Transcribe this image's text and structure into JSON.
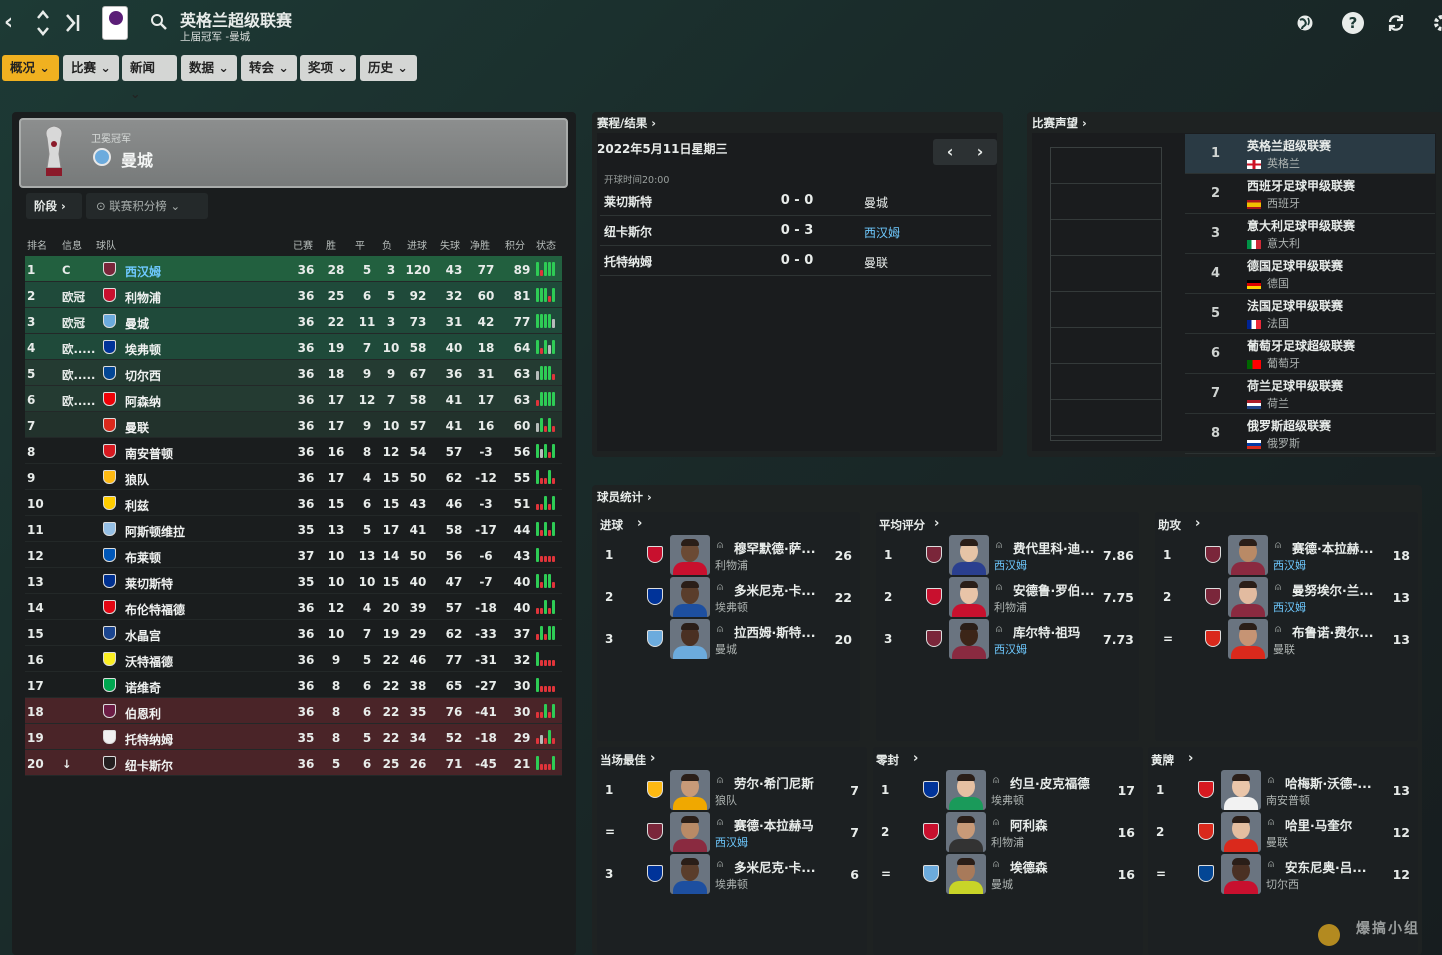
{
  "header": {
    "title": "英格兰超级联赛",
    "subtitle": "上届冠军 -曼城",
    "logo_text": "Premier League"
  },
  "menu": [
    {
      "label": "概况"
    },
    {
      "label": "比赛"
    },
    {
      "label": "新闻"
    },
    {
      "label": "数据"
    },
    {
      "label": "转会"
    },
    {
      "label": "奖项"
    },
    {
      "label": "历史"
    }
  ],
  "champion": {
    "label": "卫冕冠军",
    "team": "曼城"
  },
  "stage": {
    "label": "阶段",
    "selector": "联赛积分榜"
  },
  "table": {
    "headers": [
      "排名",
      "信息",
      "球队",
      "已赛",
      "胜",
      "平",
      "负",
      "进球",
      "失球",
      "净胜",
      "积分",
      "状态"
    ],
    "rows": [
      {
        "pos": "1",
        "info": "C",
        "team": "西汉姆",
        "p": "36",
        "w": "28",
        "d": "5",
        "l": "3",
        "gf": "120",
        "ga": "43",
        "gd": "77",
        "pts": "89",
        "color": "#7a263a",
        "zone": "cl",
        "form": "WLWWW"
      },
      {
        "pos": "2",
        "info": "欧冠",
        "team": "利物浦",
        "p": "36",
        "w": "25",
        "d": "6",
        "l": "5",
        "gf": "92",
        "ga": "32",
        "gd": "60",
        "pts": "81",
        "color": "#c8102e",
        "zone": "cl",
        "form": "WWWLW"
      },
      {
        "pos": "3",
        "info": "欧冠",
        "team": "曼城",
        "p": "36",
        "w": "22",
        "d": "11",
        "l": "3",
        "gf": "73",
        "ga": "31",
        "gd": "42",
        "pts": "77",
        "color": "#6cabdd",
        "zone": "cl",
        "form": "WWWWD"
      },
      {
        "pos": "4",
        "info": "欧.....",
        "team": "埃弗顿",
        "p": "36",
        "w": "19",
        "d": "7",
        "l": "10",
        "gf": "58",
        "ga": "40",
        "gd": "18",
        "pts": "64",
        "color": "#003399",
        "zone": "cl",
        "form": "WLWDW"
      },
      {
        "pos": "5",
        "info": "欧.....",
        "team": "切尔西",
        "p": "36",
        "w": "18",
        "d": "9",
        "l": "9",
        "gf": "67",
        "ga": "36",
        "gd": "31",
        "pts": "63",
        "color": "#034694",
        "zone": "el",
        "form": "DWWWL"
      },
      {
        "pos": "6",
        "info": "欧.....",
        "team": "阿森纳",
        "p": "36",
        "w": "17",
        "d": "12",
        "l": "7",
        "gf": "58",
        "ga": "41",
        "gd": "17",
        "pts": "63",
        "color": "#ef0107",
        "zone": "el",
        "form": "LWWWW"
      },
      {
        "pos": "7",
        "info": "",
        "team": "曼联",
        "p": "36",
        "w": "17",
        "d": "9",
        "l": "10",
        "gf": "57",
        "ga": "41",
        "gd": "16",
        "pts": "60",
        "color": "#da291c",
        "zone": "conf",
        "form": "DWLWL"
      },
      {
        "pos": "8",
        "info": "",
        "team": "南安普顿",
        "p": "36",
        "w": "16",
        "d": "8",
        "l": "12",
        "gf": "54",
        "ga": "57",
        "gd": "-3",
        "pts": "56",
        "color": "#d71920",
        "zone": "",
        "form": "WDWLW"
      },
      {
        "pos": "9",
        "info": "",
        "team": "狼队",
        "p": "36",
        "w": "17",
        "d": "4",
        "l": "15",
        "gf": "50",
        "ga": "62",
        "gd": "-12",
        "pts": "55",
        "color": "#fdb913",
        "zone": "",
        "form": "WLLWL"
      },
      {
        "pos": "10",
        "info": "",
        "team": "利兹",
        "p": "36",
        "w": "15",
        "d": "6",
        "l": "15",
        "gf": "43",
        "ga": "46",
        "gd": "-3",
        "pts": "51",
        "color": "#ffcd00",
        "zone": "",
        "form": "LLWLW"
      },
      {
        "pos": "11",
        "info": "",
        "team": "阿斯顿维拉",
        "p": "35",
        "w": "13",
        "d": "5",
        "l": "17",
        "gf": "41",
        "ga": "58",
        "gd": "-17",
        "pts": "44",
        "color": "#95bfe5",
        "zone": "",
        "form": "WLWLW"
      },
      {
        "pos": "12",
        "info": "",
        "team": "布莱顿",
        "p": "37",
        "w": "10",
        "d": "13",
        "l": "14",
        "gf": "50",
        "ga": "56",
        "gd": "-6",
        "pts": "43",
        "color": "#0057b8",
        "zone": "",
        "form": "WLLLL"
      },
      {
        "pos": "13",
        "info": "",
        "team": "莱切斯特",
        "p": "35",
        "w": "10",
        "d": "10",
        "l": "15",
        "gf": "40",
        "ga": "47",
        "gd": "-7",
        "pts": "40",
        "color": "#003090",
        "zone": "",
        "form": "WLWWL"
      },
      {
        "pos": "14",
        "info": "",
        "team": "布伦特福德",
        "p": "36",
        "w": "12",
        "d": "4",
        "l": "20",
        "gf": "39",
        "ga": "57",
        "gd": "-18",
        "pts": "40",
        "color": "#e30613",
        "zone": "",
        "form": "LLWLW"
      },
      {
        "pos": "15",
        "info": "",
        "team": "水晶宫",
        "p": "36",
        "w": "10",
        "d": "7",
        "l": "19",
        "gf": "29",
        "ga": "62",
        "gd": "-33",
        "pts": "37",
        "color": "#1b458f",
        "zone": "",
        "form": "LWLWW"
      },
      {
        "pos": "16",
        "info": "",
        "team": "沃特福德",
        "p": "36",
        "w": "9",
        "d": "5",
        "l": "22",
        "gf": "46",
        "ga": "77",
        "gd": "-31",
        "pts": "32",
        "color": "#fbee23",
        "zone": "",
        "form": "WLLLL"
      },
      {
        "pos": "17",
        "info": "",
        "team": "诺维奇",
        "p": "36",
        "w": "8",
        "d": "6",
        "l": "22",
        "gf": "38",
        "ga": "65",
        "gd": "-27",
        "pts": "30",
        "color": "#00a650",
        "zone": "",
        "form": "WLLLL"
      },
      {
        "pos": "18",
        "info": "",
        "team": "伯恩利",
        "p": "36",
        "w": "8",
        "d": "6",
        "l": "22",
        "gf": "35",
        "ga": "76",
        "gd": "-41",
        "pts": "30",
        "color": "#6c1d45",
        "zone": "rel",
        "form": "LLWLW"
      },
      {
        "pos": "19",
        "info": "",
        "team": "托特纳姆",
        "p": "35",
        "w": "8",
        "d": "5",
        "l": "22",
        "gf": "34",
        "ga": "52",
        "gd": "-18",
        "pts": "29",
        "color": "#f0f0f0",
        "zone": "rel",
        "form": "LDLWL"
      },
      {
        "pos": "20",
        "info": "↓",
        "team": "纽卡斯尔",
        "p": "36",
        "w": "5",
        "d": "6",
        "l": "25",
        "gf": "26",
        "ga": "71",
        "gd": "-45",
        "pts": "21",
        "color": "#241f20",
        "zone": "rel",
        "form": "WLLLW"
      }
    ]
  },
  "fixtures": {
    "title": "赛程/结果",
    "date": "2022年5月11日星期三",
    "kickoff": "开球时间20:00",
    "matches": [
      {
        "home": "莱切斯特",
        "score": "0 - 0",
        "away": "曼城",
        "away_link": false
      },
      {
        "home": "纽卡斯尔",
        "score": "0 - 3",
        "away": "西汉姆",
        "away_link": true
      },
      {
        "home": "托特纳姆",
        "score": "0 - 0",
        "away": "曼联",
        "away_link": false
      }
    ]
  },
  "reputation": {
    "title": "比赛声望",
    "items": [
      {
        "rank": "1",
        "name": "英格兰超级联赛",
        "country": "英格兰",
        "flag": "eng"
      },
      {
        "rank": "2",
        "name": "西班牙足球甲级联赛",
        "country": "西班牙",
        "flag": "esp"
      },
      {
        "rank": "3",
        "name": "意大利足球甲级联赛",
        "country": "意大利",
        "flag": "ita"
      },
      {
        "rank": "4",
        "name": "德国足球甲级联赛",
        "country": "德国",
        "flag": "ger"
      },
      {
        "rank": "5",
        "name": "法国足球甲级联赛",
        "country": "法国",
        "flag": "fra"
      },
      {
        "rank": "6",
        "name": "葡萄牙足球超级联赛",
        "country": "葡萄牙",
        "flag": "por"
      },
      {
        "rank": "7",
        "name": "荷兰足球甲级联赛",
        "country": "荷兰",
        "flag": "ned"
      },
      {
        "rank": "8",
        "name": "俄罗斯超级联赛",
        "country": "俄罗斯",
        "flag": "rus"
      }
    ]
  },
  "player_stats": {
    "title": "球员统计",
    "cards": [
      {
        "title": "进球",
        "rows": [
          {
            "rank": "1",
            "name": "穆罕默德·萨...",
            "club": "利物浦",
            "value": "26",
            "crest": "#c8102e",
            "skin": "#6b4a34",
            "kit": "#c8102e",
            "link": false
          },
          {
            "rank": "2",
            "name": "多米尼克·卡...",
            "club": "埃弗顿",
            "value": "22",
            "crest": "#003399",
            "skin": "#5a3d2b",
            "kit": "#1d4fa0",
            "link": false
          },
          {
            "rank": "3",
            "name": "拉西姆·斯特...",
            "club": "曼城",
            "value": "20",
            "crest": "#6cabdd",
            "skin": "#4a3023",
            "kit": "#6cabdd",
            "link": false
          }
        ]
      },
      {
        "title": "平均评分",
        "rows": [
          {
            "rank": "1",
            "name": "费代里科·迪...",
            "club": "西汉姆",
            "value": "7.86",
            "crest": "#7a263a",
            "skin": "#e6c4a6",
            "kit": "#2a3f8f",
            "link": true
          },
          {
            "rank": "2",
            "name": "安德鲁·罗伯...",
            "club": "利物浦",
            "value": "7.75",
            "crest": "#c8102e",
            "skin": "#e8c4a8",
            "kit": "#c8102e",
            "link": false
          },
          {
            "rank": "3",
            "name": "库尔特·祖玛",
            "club": "西汉姆",
            "value": "7.73",
            "crest": "#7a263a",
            "skin": "#3c2518",
            "kit": "#8a2a40",
            "link": true
          }
        ]
      },
      {
        "title": "助攻",
        "rows": [
          {
            "rank": "1",
            "name": "赛德·本拉赫...",
            "club": "西汉姆",
            "value": "18",
            "crest": "#7a263a",
            "skin": "#b98a66",
            "kit": "#8a2a40",
            "link": true
          },
          {
            "rank": "2",
            "name": "曼努埃尔·兰...",
            "club": "西汉姆",
            "value": "13",
            "crest": "#7a263a",
            "skin": "#e2bba0",
            "kit": "#8a2a40",
            "link": true
          },
          {
            "rank": "=",
            "name": "布鲁诺·费尔...",
            "club": "曼联",
            "value": "13",
            "crest": "#da291c",
            "skin": "#c69474",
            "kit": "#da291c",
            "link": false
          }
        ]
      },
      {
        "title": "当场最佳",
        "rows": [
          {
            "rank": "1",
            "name": "劳尔·希门尼斯",
            "club": "狼队",
            "value": "7",
            "crest": "#fdb913",
            "skin": "#c89a78",
            "kit": "#f0a800",
            "link": false
          },
          {
            "rank": "=",
            "name": "赛德·本拉赫马",
            "club": "西汉姆",
            "value": "7",
            "crest": "#7a263a",
            "skin": "#b98a66",
            "kit": "#8a2a40",
            "link": true
          },
          {
            "rank": "3",
            "name": "多米尼克·卡...",
            "club": "埃弗顿",
            "value": "6",
            "crest": "#003399",
            "skin": "#5a3d2b",
            "kit": "#1d4fa0",
            "link": false
          }
        ]
      },
      {
        "title": "零封",
        "rows": [
          {
            "rank": "1",
            "name": "约旦·皮克福德",
            "club": "埃弗顿",
            "value": "17",
            "crest": "#003399",
            "skin": "#e6c0a2",
            "kit": "#1a9a5a",
            "link": false
          },
          {
            "rank": "2",
            "name": "阿利森",
            "club": "利物浦",
            "value": "16",
            "crest": "#c8102e",
            "skin": "#c89a78",
            "kit": "#333333",
            "link": false
          },
          {
            "rank": "=",
            "name": "埃德森",
            "club": "曼城",
            "value": "16",
            "crest": "#6cabdd",
            "skin": "#a87a5a",
            "kit": "#c8d428",
            "link": false
          }
        ]
      },
      {
        "title": "黄牌",
        "rows": [
          {
            "rank": "1",
            "name": "哈梅斯·沃德-...",
            "club": "南安普顿",
            "value": "13",
            "crest": "#d71920",
            "skin": "#eac6aa",
            "kit": "#f2f2f2",
            "link": false
          },
          {
            "rank": "2",
            "name": "哈里·马奎尔",
            "club": "曼联",
            "value": "12",
            "crest": "#da291c",
            "skin": "#e4bea0",
            "kit": "#da291c",
            "link": false
          },
          {
            "rank": "=",
            "name": "安东尼奥·吕...",
            "club": "切尔西",
            "value": "12",
            "crest": "#034694",
            "skin": "#4a3023",
            "kit": "#c8102e",
            "link": false
          }
        ]
      }
    ]
  },
  "watermark": "爆搞小组"
}
